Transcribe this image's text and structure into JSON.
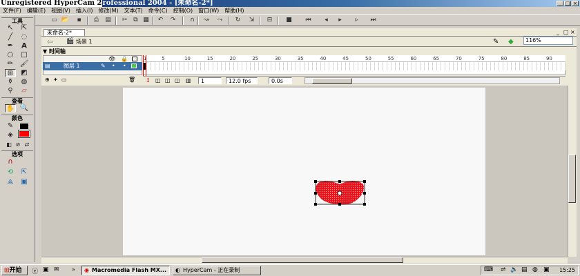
{
  "window": {
    "title_overlay": "Unregistered HyperCam 2",
    "title_rest": "rofessional 2004 - [未命名-2*]"
  },
  "menu": [
    "文件(F)",
    "编辑(E)",
    "视图(V)",
    "插入(I)",
    "修改(M)",
    "文本(T)",
    "命令(C)",
    "控制(O)",
    "窗口(W)",
    "帮助(H)"
  ],
  "tools_panel": {
    "header_tools": "工具",
    "header_view": "查看",
    "header_colors": "颜色",
    "header_options": "选项",
    "stroke_color": "#000000",
    "fill_color": "#ff0000"
  },
  "document": {
    "tab_label": "未命名-2*",
    "scene_label": "场景 1",
    "zoom": "116%"
  },
  "timeline": {
    "header": "时间轴",
    "layer_name": "图层 1",
    "frame_numbers": [
      "1",
      "5",
      "10",
      "15",
      "20",
      "25",
      "30",
      "35",
      "40",
      "45",
      "50",
      "55",
      "60",
      "65",
      "70",
      "75",
      "80",
      "85",
      "90"
    ],
    "current_frame": "1",
    "fps": "12.0 fps",
    "time": "0.0s"
  },
  "stage": {
    "shape_color": "#e8141c",
    "background": "#f8f8f8"
  },
  "taskbar": {
    "start_label": "开始",
    "tasks": [
      "Macromedia Flash MX...",
      "HyperCam - 正在录制"
    ],
    "clock": "15:25"
  }
}
